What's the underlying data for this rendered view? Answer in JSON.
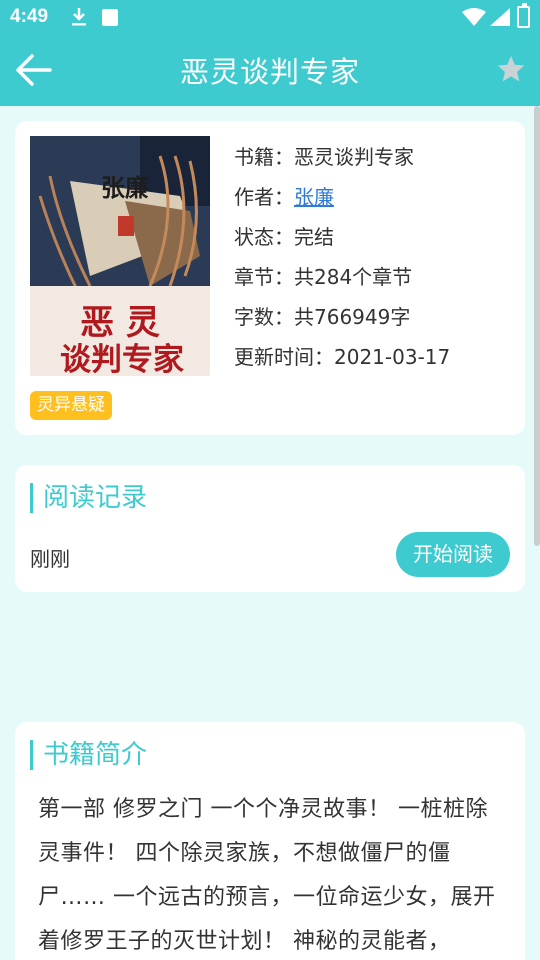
{
  "status": {
    "time": "4:49"
  },
  "header": {
    "title": "恶灵谈判专家"
  },
  "book": {
    "cover_author": "张廉",
    "cover_title_line1": "恶 灵",
    "cover_title_line2": "谈判专家",
    "rows": [
      {
        "label": "书籍：",
        "value": "恶灵谈判专家"
      },
      {
        "label": "作者：",
        "value": "张廉"
      },
      {
        "label": "状态：",
        "value": "完结"
      },
      {
        "label": "章节：",
        "value": "共284个章节"
      },
      {
        "label": "字数：",
        "value": "共766949字"
      },
      {
        "label": "更新时间：",
        "value": "2021-03-17"
      }
    ],
    "tag": "灵异悬疑"
  },
  "record": {
    "title": "阅读记录",
    "time": "刚刚",
    "start_label": "开始阅读"
  },
  "intro": {
    "title": "书籍简介",
    "text": "第一部 修罗之门 一个个净灵故事！ 一桩桩除灵事件！ 四个除灵家族，不想做僵尸的僵尸…… 一个远古的预言，一位命运少女，展开着修罗王子的灭世计划！ 神秘的灵能者，"
  },
  "colors": {
    "accent": "#3ecbd0",
    "tag": "#ffbf1e",
    "link": "#2e7bd6",
    "background": "#e6fafa"
  }
}
